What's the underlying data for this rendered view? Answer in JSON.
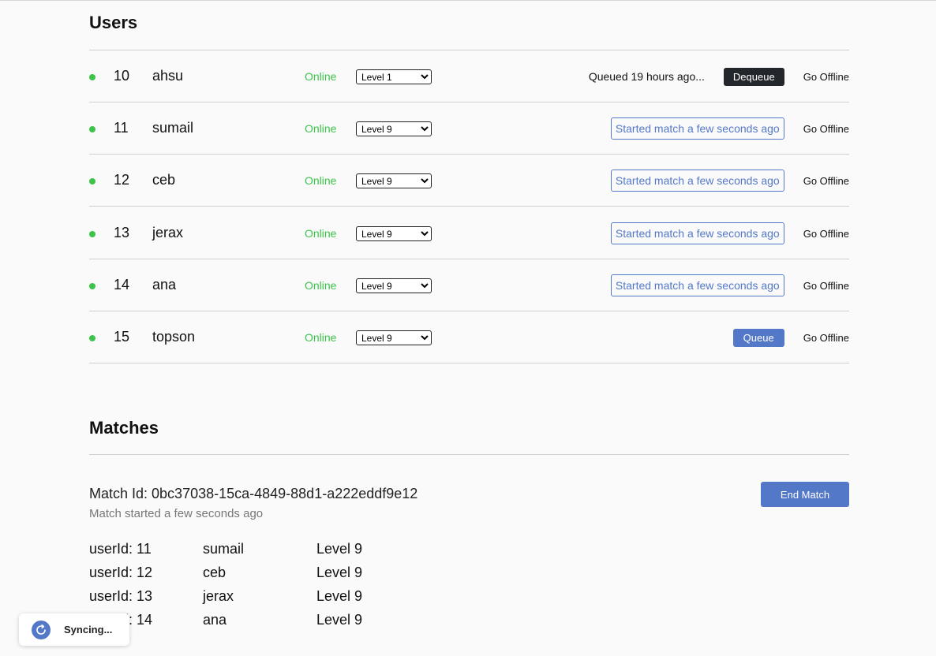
{
  "users_section": {
    "title": "Users",
    "rows": [
      {
        "id": "10",
        "name": "ahsu",
        "status": "Online",
        "level": "Level 1",
        "queued_text": "Queued 19 hours ago...",
        "action_label": "Dequeue",
        "offline_label": "Go Offline"
      },
      {
        "id": "11",
        "name": "sumail",
        "status": "Online",
        "level": "Level 9",
        "action_label": "Started match a few seconds ago",
        "offline_label": "Go Offline"
      },
      {
        "id": "12",
        "name": "ceb",
        "status": "Online",
        "level": "Level 9",
        "action_label": "Started match a few seconds ago",
        "offline_label": "Go Offline"
      },
      {
        "id": "13",
        "name": "jerax",
        "status": "Online",
        "level": "Level 9",
        "action_label": "Started match a few seconds ago",
        "offline_label": "Go Offline"
      },
      {
        "id": "14",
        "name": "ana",
        "status": "Online",
        "level": "Level 9",
        "action_label": "Started match a few seconds ago",
        "offline_label": "Go Offline"
      },
      {
        "id": "15",
        "name": "topson",
        "status": "Online",
        "level": "Level 9",
        "action_label": "Queue",
        "offline_label": "Go Offline"
      }
    ]
  },
  "matches_section": {
    "title": "Matches",
    "match": {
      "id_text": "Match Id: 0bc37038-15ca-4849-88d1-a222eddf9e12",
      "started_text": "Match started a few seconds ago",
      "end_label": "End Match",
      "players": [
        {
          "user": "userId: 11",
          "name": "sumail",
          "level": "Level 9"
        },
        {
          "user": "userId: 12",
          "name": "ceb",
          "level": "Level 9"
        },
        {
          "user": "userId: 13",
          "name": "jerax",
          "level": "Level 9"
        },
        {
          "user": "userId: 14",
          "name": "ana",
          "level": "Level 9"
        }
      ]
    }
  },
  "toast": {
    "label": "Syncing..."
  },
  "colors": {
    "online": "#3cc34a",
    "accent": "#5478c8",
    "dark_button": "#23262b"
  }
}
